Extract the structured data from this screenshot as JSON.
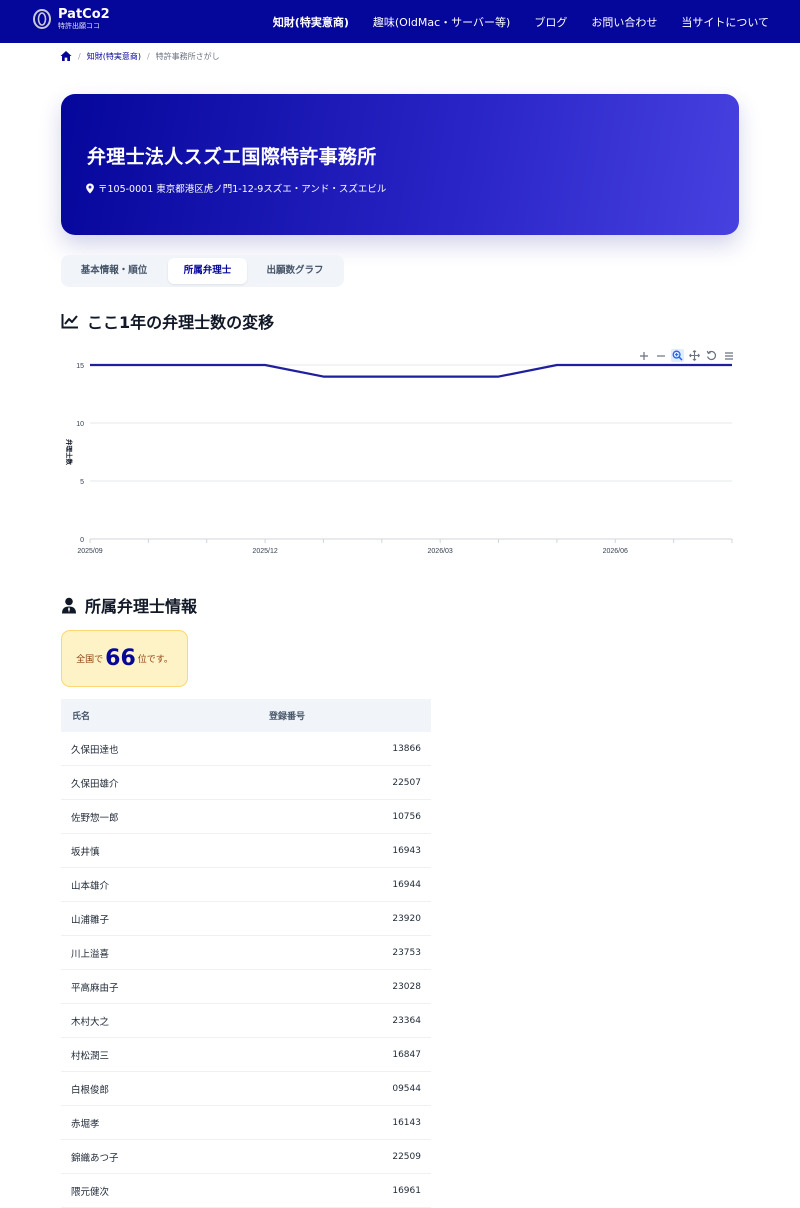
{
  "header": {
    "brand_name": "PatCo2",
    "brand_sub": "特許出願ココ",
    "nav": [
      {
        "label": "知財(特実意商)",
        "active": true
      },
      {
        "label": "趣味(OldMac・サーバー等)",
        "active": false
      },
      {
        "label": "ブログ",
        "active": false
      },
      {
        "label": "お問い合わせ",
        "active": false
      },
      {
        "label": "当サイトについて",
        "active": false
      }
    ]
  },
  "breadcrumb": {
    "items": [
      "知財(特実意商)",
      "特許事務所さがし"
    ]
  },
  "hero": {
    "title": "弁理士法人スズエ国際特許事務所",
    "address": "〒105-0001 東京都港区虎ノ門1-12-9スズエ・アンド・スズエビル"
  },
  "tabs": [
    "基本情報・順位",
    "所属弁理士",
    "出願数グラフ"
  ],
  "sections": {
    "trend_title": "ここ1年の弁理士数の変移",
    "members_title": "所属弁理士情報"
  },
  "chart_data": {
    "type": "line",
    "ylabel": "弁理士数",
    "ylim": [
      0,
      15
    ],
    "yticks": [
      0,
      5,
      10,
      15
    ],
    "x_tick_labels": [
      "2025/09",
      "2025/12",
      "2026/03",
      "2026/06"
    ],
    "x_months": [
      "2025/09",
      "2025/10",
      "2025/11",
      "2025/12",
      "2026/01",
      "2026/02",
      "2026/03",
      "2026/04",
      "2026/05",
      "2026/06",
      "2026/07",
      "2026/08"
    ],
    "series": [
      {
        "name": "",
        "values": [
          15,
          15,
          15,
          15,
          14,
          14,
          14,
          14,
          15,
          15,
          15,
          15
        ],
        "color": "#1f1f9e"
      }
    ],
    "grid": true
  },
  "toolbar_icons": [
    "zoom-in-icon",
    "zoom-out-icon",
    "selection-zoom-icon",
    "pan-icon",
    "reset-icon",
    "menu-icon"
  ],
  "rank": {
    "prefix": "全国で",
    "value": "66",
    "suffix": "位です。"
  },
  "table": {
    "headers": [
      "氏名",
      "登録番号"
    ],
    "rows": [
      {
        "name": "久保田達也",
        "reg": "13866"
      },
      {
        "name": "久保田雄介",
        "reg": "22507"
      },
      {
        "name": "佐野惣一郎",
        "reg": "10756"
      },
      {
        "name": "坂井慎",
        "reg": "16943"
      },
      {
        "name": "山本雄介",
        "reg": "16944"
      },
      {
        "name": "山浦雛子",
        "reg": "23920"
      },
      {
        "name": "川上溢喜",
        "reg": "23753"
      },
      {
        "name": "平高麻由子",
        "reg": "23028"
      },
      {
        "name": "木村大之",
        "reg": "23364"
      },
      {
        "name": "村松潤三",
        "reg": "16847"
      },
      {
        "name": "白根俊郎",
        "reg": "09544"
      },
      {
        "name": "赤堀孝",
        "reg": "16143"
      },
      {
        "name": "錦織あつ子",
        "reg": "22509"
      },
      {
        "name": "隈元健次",
        "reg": "16961"
      }
    ]
  },
  "colors": {
    "primary": "#05069a",
    "accent": "#4741e0",
    "rank_bg": "#fef3c7",
    "line": "#1f1f9e"
  }
}
